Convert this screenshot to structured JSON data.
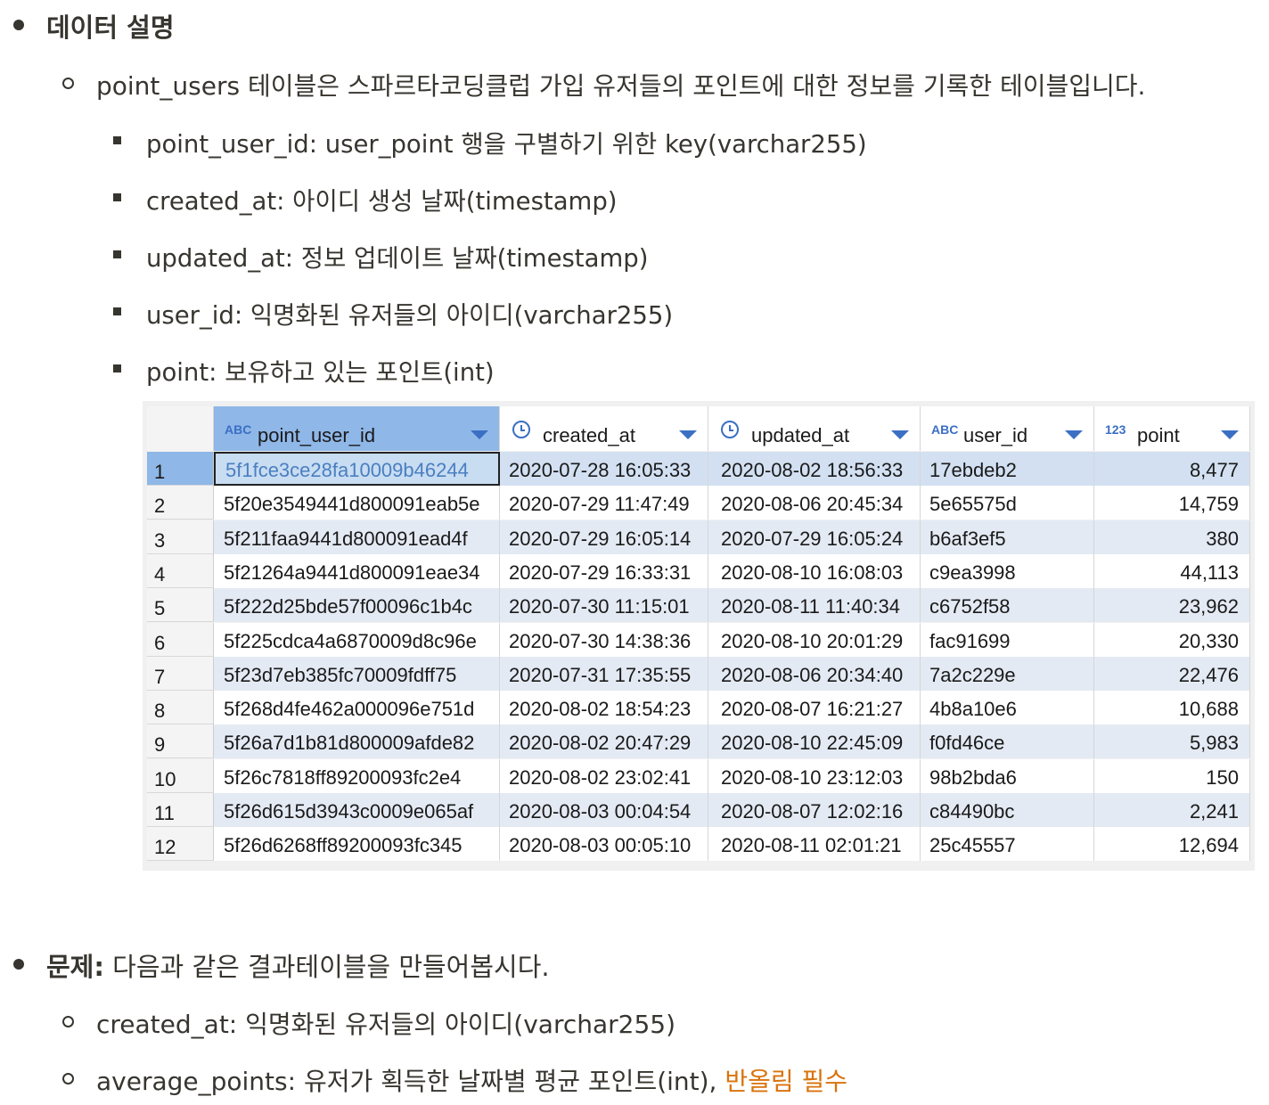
{
  "section1": {
    "title": "데이터 설명",
    "intro": "point_users 테이블은 스파르타코딩클럽 가입 유저들의 포인트에 대한 정보를 기록한 테이블입니다.",
    "fields": [
      "point_user_id: user_point 행을 구별하기 위한 key(varchar255)",
      "created_at: 아이디 생성 날짜(timestamp)",
      "updated_at: 정보 업데이트 날짜(timestamp)",
      "user_id: 익명화된 유저들의 아이디(varchar255)",
      "point: 보유하고 있는 포인트(int)"
    ]
  },
  "table": {
    "columns": [
      {
        "label": "point_user_id",
        "type_icon": "ABC"
      },
      {
        "label": "created_at",
        "type_icon": "clock-icon"
      },
      {
        "label": "updated_at",
        "type_icon": "clock-icon"
      },
      {
        "label": "user_id",
        "type_icon": "ABC"
      },
      {
        "label": "point",
        "type_icon": "123"
      }
    ],
    "rows": [
      [
        "1",
        "5f1fce3ce28fa10009b46244",
        "2020-07-28 16:05:33",
        "2020-08-02 18:56:33",
        "17ebdeb2",
        "8,477"
      ],
      [
        "2",
        "5f20e3549441d800091eab5e",
        "2020-07-29 11:47:49",
        "2020-08-06 20:45:34",
        "5e65575d",
        "14,759"
      ],
      [
        "3",
        "5f211faa9441d800091ead4f",
        "2020-07-29 16:05:14",
        "2020-07-29 16:05:24",
        "b6af3ef5",
        "380"
      ],
      [
        "4",
        "5f21264a9441d800091eae34",
        "2020-07-29 16:33:31",
        "2020-08-10 16:08:03",
        "c9ea3998",
        "44,113"
      ],
      [
        "5",
        "5f222d25bde57f00096c1b4c",
        "2020-07-30 11:15:01",
        "2020-08-11 11:40:34",
        "c6752f58",
        "23,962"
      ],
      [
        "6",
        "5f225cdca4a6870009d8c96e",
        "2020-07-30 14:38:36",
        "2020-08-10 20:01:29",
        "fac91699",
        "20,330"
      ],
      [
        "7",
        "5f23d7eb385fc70009fdff75",
        "2020-07-31 17:35:55",
        "2020-08-06 20:34:40",
        "7a2c229e",
        "22,476"
      ],
      [
        "8",
        "5f268d4fe462a000096e751d",
        "2020-08-02 18:54:23",
        "2020-08-07 16:21:27",
        "4b8a10e6",
        "10,688"
      ],
      [
        "9",
        "5f26a7d1b81d800009afde82",
        "2020-08-02 20:47:29",
        "2020-08-10 22:45:09",
        "f0fd46ce",
        "5,983"
      ],
      [
        "10",
        "5f26c7818ff89200093fc2e4",
        "2020-08-02 23:02:41",
        "2020-08-10 23:12:03",
        "98b2bda6",
        "150"
      ],
      [
        "11",
        "5f26d615d3943c0009e065af",
        "2020-08-03 00:04:54",
        "2020-08-07 12:02:16",
        "c84490bc",
        "2,241"
      ],
      [
        "12",
        "5f26d6268ff89200093fc345",
        "2020-08-03 00:05:10",
        "2020-08-11 02:01:21",
        "25c45557",
        "12,694"
      ]
    ]
  },
  "section2": {
    "label": "문제:",
    "text": " 다음과 같은 결과테이블을 만들어봅시다.",
    "items": [
      {
        "text": "created_at: 익명화된 유저들의 아이디(varchar255)"
      },
      {
        "text": "average_points: 유저가 획득한 날짜별 평균 포인트(int), ",
        "accent": "반올림 필수"
      }
    ]
  },
  "colors": {
    "accent": "#d9730d",
    "selected_header": "#8fb7e8",
    "alt_row": "#e4eaf4"
  }
}
